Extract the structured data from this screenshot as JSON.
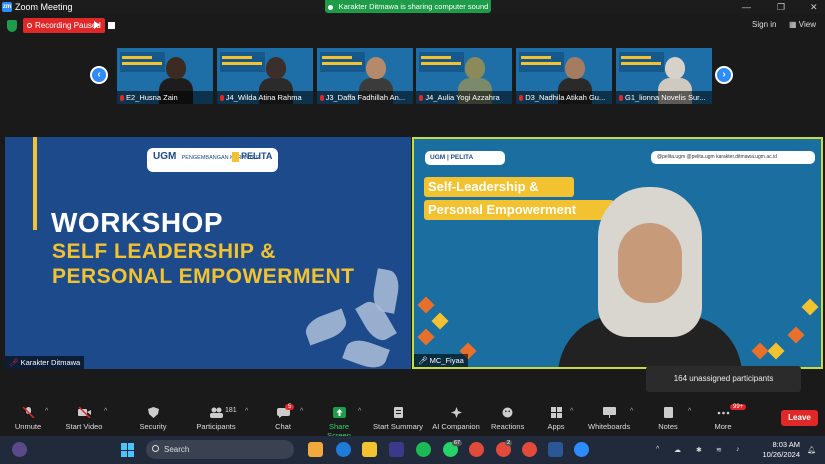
{
  "window": {
    "title": "Zoom Meeting",
    "min_label": "—",
    "max_label": "❐",
    "close_label": "✕"
  },
  "share_banner": {
    "text": "Karakter Ditmawa is sharing computer sound"
  },
  "recording": {
    "label": "Recording Paused"
  },
  "header": {
    "sign_in": "Sign in",
    "view": "View",
    "view_icon": "grid-icon"
  },
  "thumbnail_strip": {
    "tiles": [
      {
        "name": "E2_Husna Zain",
        "skin": "#3b2b22",
        "cloth": "#1d1d1d"
      },
      {
        "name": "J4_Wilda Atina Rahma",
        "skin": "#3a2f2b",
        "cloth": "#2b2b2b"
      },
      {
        "name": "J3_Daffa Fadhillah An...",
        "skin": "#b58a6a",
        "cloth": "#3b3b3b"
      },
      {
        "name": "J4_Aulia Yogi Azzahra",
        "skin": "#8a8a5a",
        "cloth": "#7a8a6a"
      },
      {
        "name": "D3_Nadhila Atikah Gu...",
        "skin": "#a37c62",
        "cloth": "#2a2a2a"
      },
      {
        "name": "G1_lionna Novelis Sur...",
        "skin": "#d7d2c9",
        "cloth": "#cfc9bf"
      }
    ]
  },
  "left_panel": {
    "logo_ugm": "UGM",
    "logo_sub": "PENGEMBANGAN KARAKTER",
    "logo_pelita": "PELITA",
    "line1": "WORKSHOP",
    "line2": "SELF LEADERSHIP &",
    "line3": "PERSONAL EMPOWERMENT",
    "name": "Karakter Ditmawa"
  },
  "right_panel": {
    "logo": "UGM | PELITA",
    "social": "@pelita.ugm   @pelita.ugm   karakter.ditmawa.ugm.ac.id",
    "banner1": "Self-Leadership &",
    "banner2": "Personal Empowerment",
    "name": "MC_Fiyaa"
  },
  "notice": {
    "text": "164 unassigned participants"
  },
  "toolbar": {
    "unmute": "Unmute",
    "start_video": "Start Video",
    "security": "Security",
    "participants": "Participants",
    "participants_count": "181",
    "chat": "Chat",
    "chat_badge": "5",
    "share_screen": "Share Screen",
    "start_summary": "Start Summary",
    "ai_companion": "AI Companion",
    "reactions": "Reactions",
    "apps": "Apps",
    "whiteboards": "Whiteboards",
    "notes": "Notes",
    "more": "More",
    "more_badge": "99+",
    "leave": "Leave"
  },
  "taskbar": {
    "search_placeholder": "Search",
    "whatsapp_badge": "67",
    "chrome_badge": "2",
    "time": "8:03 AM",
    "date": "10/26/2024"
  },
  "colors": {
    "accent": "#2d8cff",
    "recording": "#e02828",
    "share_green": "#1f9c4a",
    "gold": "#f2c230",
    "slide_blue": "#1d4a8a"
  }
}
